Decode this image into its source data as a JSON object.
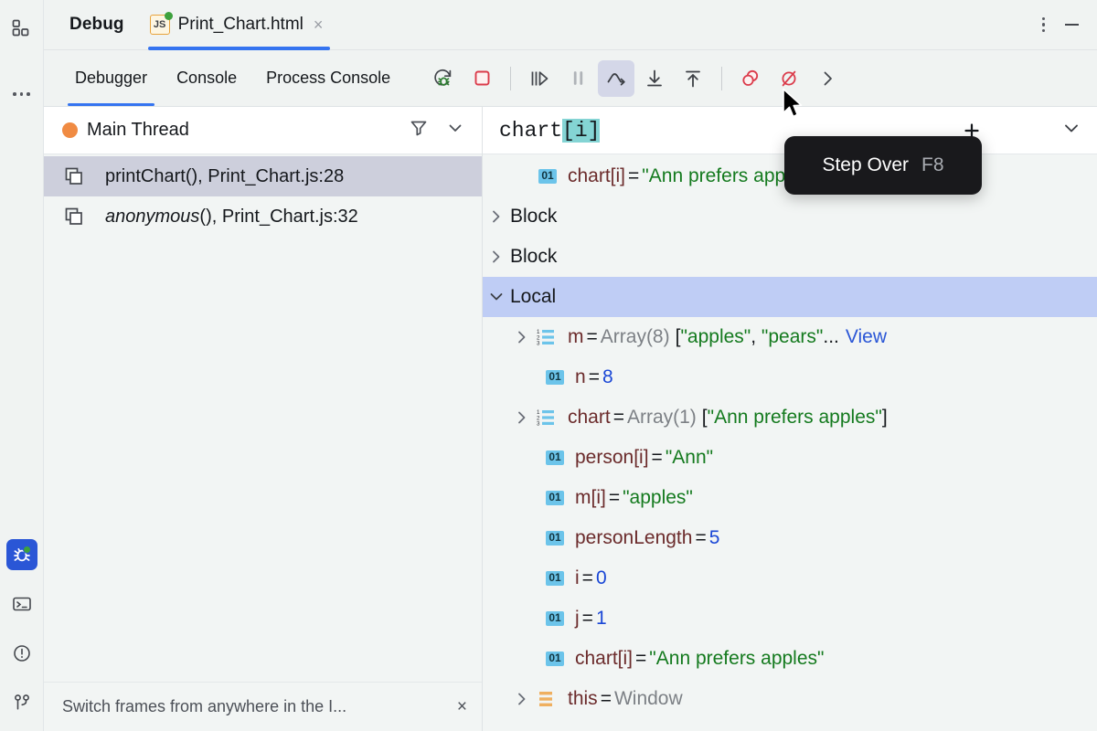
{
  "rail": {
    "top": [
      {
        "name": "project-structure-icon",
        "label": "Project Structure"
      },
      {
        "name": "more-options-icon",
        "label": "More Tool Windows"
      }
    ],
    "bottom": [
      {
        "name": "debug-icon",
        "label": "Debug",
        "active": true,
        "indicator": "running"
      },
      {
        "name": "terminal-icon",
        "label": "Terminal",
        "active": false
      },
      {
        "name": "problems-icon",
        "label": "Problems",
        "active": false
      },
      {
        "name": "version-control-icon",
        "label": "Version Control",
        "active": false
      }
    ]
  },
  "titlebar": {
    "tool_title": "Debug",
    "file_tab": {
      "badge": "JS",
      "name": "Print_Chart.html",
      "close": "×",
      "modified": true
    },
    "options_label": "Options",
    "minimize_label": "Hide"
  },
  "tabs": [
    {
      "label": "Debugger",
      "active": true
    },
    {
      "label": "Console",
      "active": false
    },
    {
      "label": "Process Console",
      "active": false
    }
  ],
  "toolbar": [
    {
      "name": "rerun-button",
      "label": "Rerun",
      "state": "normal"
    },
    {
      "name": "stop-button",
      "label": "Stop",
      "state": "normal"
    },
    {
      "name": "separator-1",
      "label": "",
      "state": "separator"
    },
    {
      "name": "resume-button",
      "label": "Resume Program",
      "state": "normal"
    },
    {
      "name": "pause-button",
      "label": "Pause Program",
      "state": "disabled"
    },
    {
      "name": "step-over-button",
      "label": "Step Over",
      "state": "highlight"
    },
    {
      "name": "step-into-button",
      "label": "Step Into",
      "state": "normal"
    },
    {
      "name": "step-out-button",
      "label": "Step Out",
      "state": "normal"
    },
    {
      "name": "separator-2",
      "label": "",
      "state": "separator"
    },
    {
      "name": "view-breakpoints-button",
      "label": "View Breakpoints",
      "state": "normal"
    },
    {
      "name": "mute-breakpoints-button",
      "label": "Mute Breakpoints",
      "state": "normal"
    },
    {
      "name": "overflow-button",
      "label": "More",
      "state": "normal"
    }
  ],
  "tooltip": {
    "label": "Step Over",
    "shortcut": "F8"
  },
  "frames": {
    "thread": "Main Thread",
    "filter_label": "Filter",
    "expand_label": "Select Thread",
    "items": [
      {
        "fn": "printChart",
        "parens": "()",
        "rest": ", Print_Chart.js:28",
        "italic": false,
        "selected": true
      },
      {
        "fn": "anonymous",
        "parens": "()",
        "rest": ", Print_Chart.js:32",
        "italic": true,
        "selected": false
      }
    ],
    "hint": "Switch frames from anywhere in the I...",
    "hint_close": "×"
  },
  "variables": {
    "watch_expression_prefix": "chart",
    "watch_expression_highlight": "[i]",
    "add_watch_label": "+",
    "collapse_label": "Collapse",
    "rows": [
      {
        "icon": "badge01",
        "indent": 1,
        "twisty": "none",
        "name": "chart[i]",
        "eq": "=",
        "value": "\"Ann prefers apples\"",
        "value_kind": "string",
        "selected": false
      },
      {
        "icon": "none",
        "indent": 0,
        "twisty": "collapsed",
        "name": "Block",
        "eq": "",
        "value": "",
        "value_kind": "scope",
        "selected": false
      },
      {
        "icon": "none",
        "indent": 0,
        "twisty": "collapsed",
        "name": "Block",
        "eq": "",
        "value": "",
        "value_kind": "scope",
        "selected": false
      },
      {
        "icon": "none",
        "indent": 0,
        "twisty": "expanded",
        "name": "Local",
        "eq": "",
        "value": "",
        "value_kind": "scope",
        "selected": true
      },
      {
        "icon": "array",
        "indent": 2,
        "twisty": "collapsed",
        "name": "m",
        "eq": "=",
        "type": "Array(8)",
        "value": "[\"apples\", \"pears\",... View",
        "value_kind": "array-preview",
        "selected": false,
        "preview_open": "[",
        "preview_items": [
          "\"apples\"",
          "\"pears\""
        ],
        "preview_ellipsis": "...",
        "view_link": "View"
      },
      {
        "icon": "badge01",
        "indent": 2,
        "twisty": "none",
        "name": "n",
        "eq": "=",
        "value": "8",
        "value_kind": "number",
        "selected": false
      },
      {
        "icon": "array",
        "indent": 2,
        "twisty": "collapsed",
        "name": "chart",
        "eq": "=",
        "type": "Array(1)",
        "value": "[\"Ann prefers apples\"]",
        "value_kind": "array-preview",
        "selected": false,
        "preview_open": "[",
        "preview_items": [
          "\"Ann prefers apples\""
        ],
        "preview_close": "]"
      },
      {
        "icon": "badge01",
        "indent": 2,
        "twisty": "none",
        "name": "person[i]",
        "eq": "=",
        "value": "\"Ann\"",
        "value_kind": "string",
        "selected": false
      },
      {
        "icon": "badge01",
        "indent": 2,
        "twisty": "none",
        "name": "m[i]",
        "eq": "=",
        "value": "\"apples\"",
        "value_kind": "string",
        "selected": false
      },
      {
        "icon": "badge01",
        "indent": 2,
        "twisty": "none",
        "name": "personLength",
        "eq": "=",
        "value": "5",
        "value_kind": "number",
        "selected": false
      },
      {
        "icon": "badge01",
        "indent": 2,
        "twisty": "none",
        "name": "i",
        "eq": "=",
        "value": "0",
        "value_kind": "number",
        "selected": false
      },
      {
        "icon": "badge01",
        "indent": 2,
        "twisty": "none",
        "name": "j",
        "eq": "=",
        "value": "1",
        "value_kind": "number",
        "selected": false
      },
      {
        "icon": "badge01",
        "indent": 2,
        "twisty": "none",
        "name": "chart[i]",
        "eq": "=",
        "value": "\"Ann prefers apples\"",
        "value_kind": "string",
        "selected": false
      },
      {
        "icon": "object",
        "indent": 1,
        "twisty": "collapsed",
        "name": "this",
        "eq": "=",
        "value": "Window",
        "value_kind": "type",
        "selected": false
      }
    ]
  },
  "colors": {
    "accent_blue": "#3574F0",
    "selection_blue": "#BFCDF5",
    "frame_selection": "#CDCFDC",
    "string_green": "#147A1E",
    "number_blue": "#1A47D6",
    "name_maroon": "#6B2B2B",
    "type_gray": "#7C8085",
    "badge_cyan": "#6CC4EA",
    "thread_orange": "#F08B43",
    "breakpoint_red": "#DB3B4B",
    "search_highlight": "#84D4D4",
    "tooltip_bg": "#19191C"
  }
}
